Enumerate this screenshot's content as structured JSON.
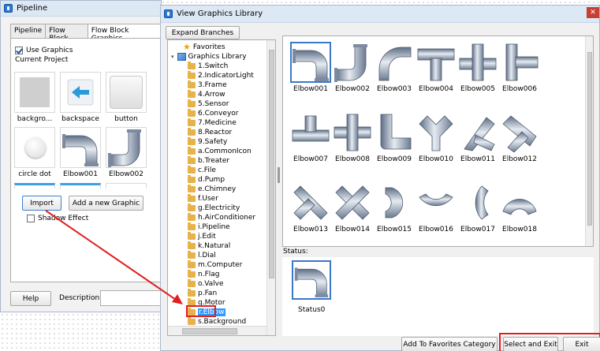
{
  "pipeline": {
    "title": "Pipeline",
    "tabs": [
      "Pipeline",
      "Flow Block",
      "Flow Block Graphics"
    ],
    "use_graphics": "Use Graphics",
    "current_project": "Current Project",
    "thumbnails": [
      "backgro...",
      "backspace",
      "button",
      "circle dot",
      "Elbow001",
      "Elbow002"
    ],
    "import_label": "Import",
    "add_graphic_label": "Add a new Graphic",
    "shadow_effect": "Shadow Effect",
    "help_label": "Help",
    "description_label": "Description:"
  },
  "library": {
    "title": "View Graphics Library",
    "expand_branches": "Expand Branches",
    "close_glyph": "✕",
    "tree": {
      "favorites": "Favorites",
      "root": "Graphics Library",
      "items": [
        "1.Switch",
        "2.IndicatorLight",
        "3.Frame",
        "4.Arrow",
        "5.Sensor",
        "6.Conveyor",
        "7.Medicine",
        "8.Reactor",
        "9.Safety",
        "a.CommonIcon",
        "b.Treater",
        "c.File",
        "d.Pump",
        "e.Chimney",
        "f.User",
        "g.Electricity",
        "h.AirConditioner",
        "i.Pipeline",
        "j.Edit",
        "k.Natural",
        "l.Dial",
        "m.Computer",
        "n.Flag",
        "o.Valve",
        "p.Fan",
        "q.Motor",
        "r.Elbow",
        "s.Background"
      ],
      "selected": "r.Elbow"
    },
    "graphics": [
      "Elbow001",
      "Elbow002",
      "Elbow003",
      "Elbow004",
      "Elbow005",
      "Elbow006",
      "Elbow007",
      "Elbow008",
      "Elbow009",
      "Elbow010",
      "Elbow011",
      "Elbow012",
      "Elbow013",
      "Elbow014",
      "Elbow015",
      "Elbow016",
      "Elbow017",
      "Elbow018"
    ],
    "selected_graphic": "Elbow001",
    "status_label": "Status:",
    "status_item": "Status0",
    "add_favorites_label": "Add To Favorites Category",
    "select_exit_label": "Select and Exit",
    "exit_label": "Exit"
  },
  "colors": {
    "pipe_light": "#e6ebf2",
    "pipe_mid": "#a6b3c4",
    "pipe_dark": "#5f6f86",
    "annotation": "#e02020",
    "selection": "#3399ff"
  },
  "icons": {
    "favorites": "star-icon",
    "folder": "folder-icon",
    "library": "library-icon",
    "tree_toggle": "collapse-arrow-icon"
  }
}
